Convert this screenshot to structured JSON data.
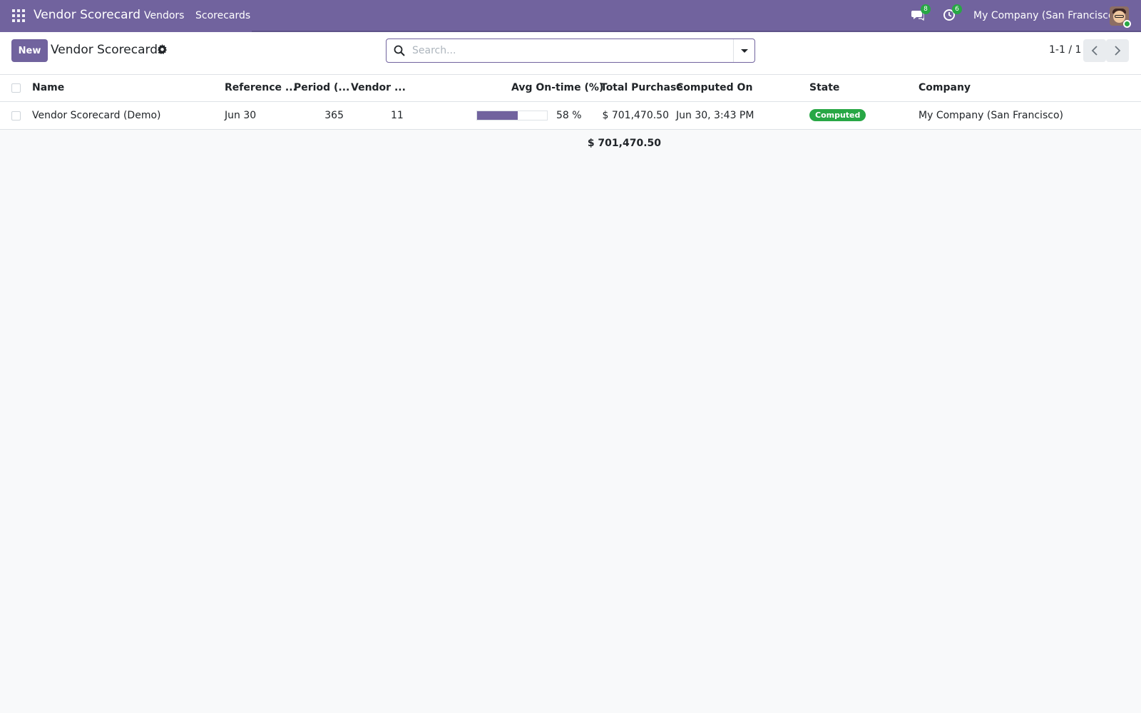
{
  "navbar": {
    "app_title": "Vendor Scorecard",
    "menu": [
      "Vendors",
      "Scorecards"
    ],
    "messages_count": "8",
    "activities_count": "6",
    "company": "My Company (San Francisco)"
  },
  "control_panel": {
    "new_label": "New",
    "title": "Vendor Scorecards",
    "search_placeholder": "Search...",
    "pager": "1-1 / 1"
  },
  "table": {
    "columns": [
      "Name",
      "Reference ...",
      "Period (...",
      "Vendor ...",
      "Avg On-time (%)",
      "Total Purchase",
      "Computed On",
      "State",
      "Company"
    ],
    "rows": [
      {
        "name": "Vendor Scorecard (Demo)",
        "reference": "Jun 30",
        "period": "365",
        "vendor": "11",
        "avg_ontime_label": "58 %",
        "avg_ontime_value": 58,
        "total_purchase": "$ 701,470.50",
        "computed_on": "Jun 30, 3:43 PM",
        "state": "Computed",
        "company": "My Company (San Francisco)"
      }
    ],
    "footer_total": "$ 701,470.50"
  },
  "colors": {
    "brand": "#71639e",
    "badge_green": "#28a745"
  }
}
